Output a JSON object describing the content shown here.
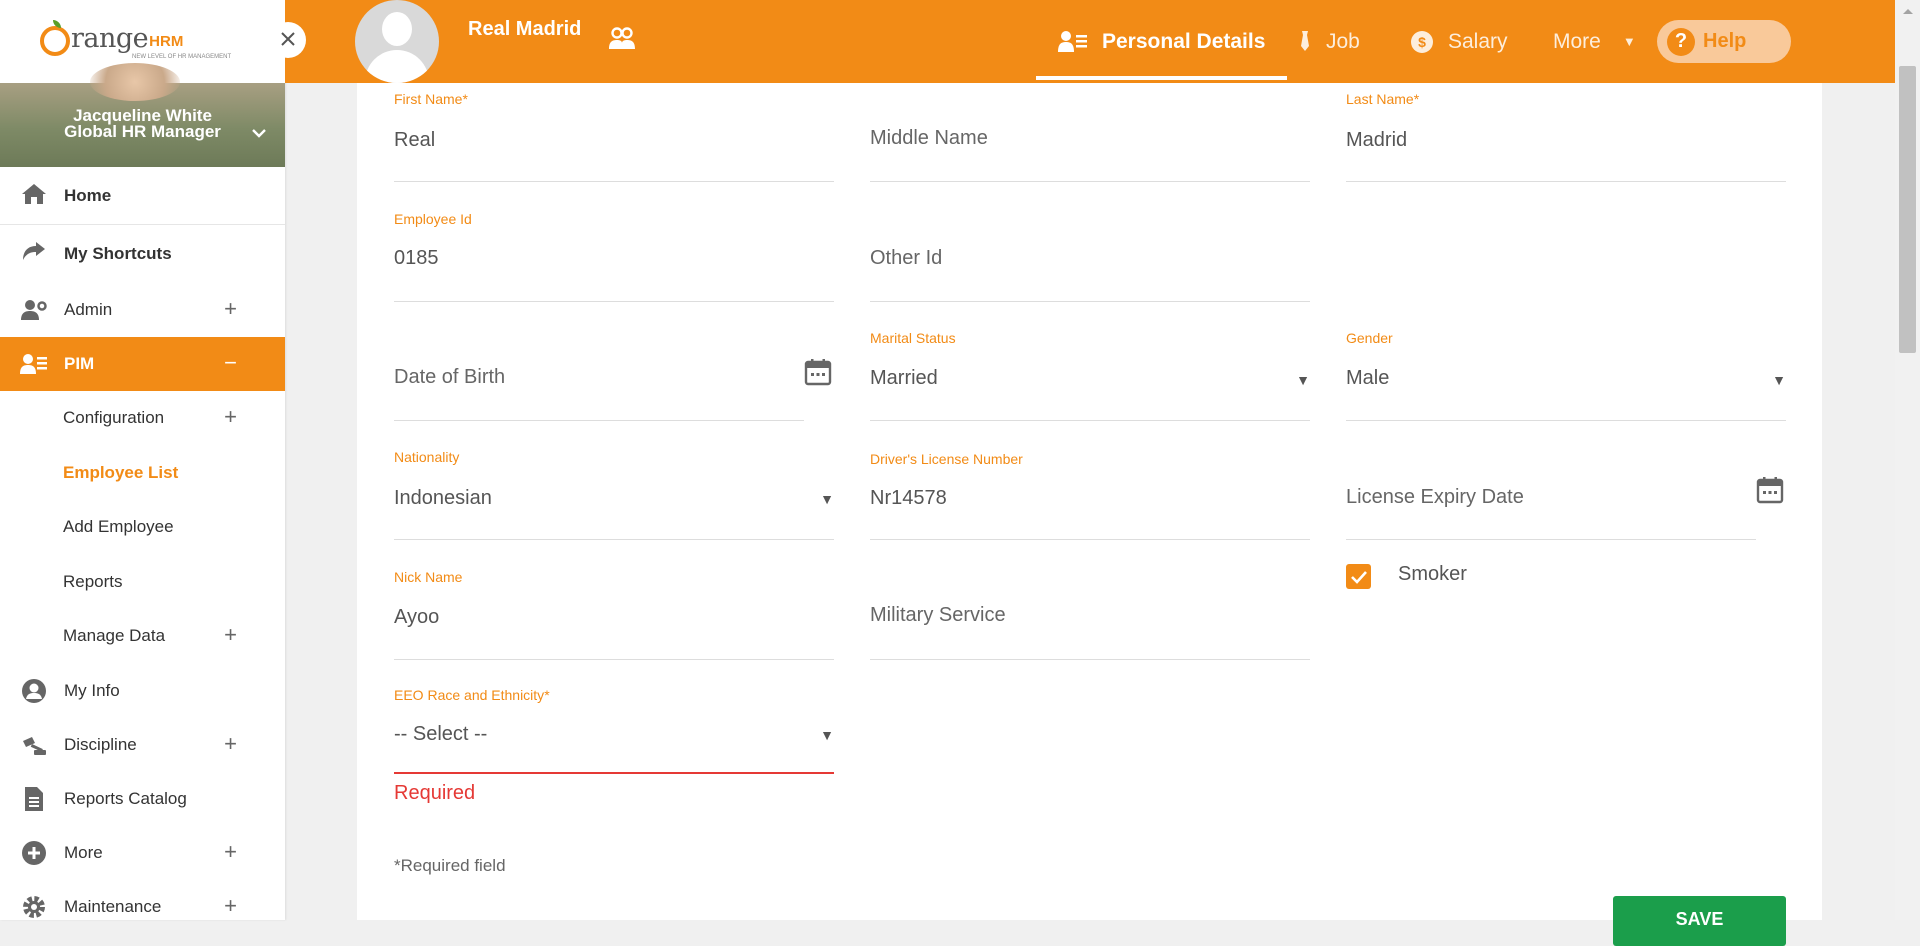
{
  "sidebar": {
    "logo": {
      "text": "range",
      "hrm": "HRM",
      "tagline": "NEW LEVEL OF HR MANAGEMENT"
    },
    "user": {
      "name": "Jacqueline White",
      "role": "Global HR Manager"
    },
    "items": [
      {
        "label": "Home",
        "icon": "home-icon"
      },
      {
        "label": "My Shortcuts",
        "icon": "share-icon"
      },
      {
        "label": "Admin",
        "icon": "admin-icon"
      },
      {
        "label": "PIM",
        "icon": "pim-icon"
      },
      {
        "label": "My Info",
        "icon": "user-circle-icon"
      },
      {
        "label": "Discipline",
        "icon": "discipline-icon"
      },
      {
        "label": "Reports Catalog",
        "icon": "document-icon"
      },
      {
        "label": "More",
        "icon": "plus-circle-icon"
      },
      {
        "label": "Maintenance",
        "icon": "gear-icon"
      }
    ],
    "pim_sub": [
      {
        "label": "Configuration"
      },
      {
        "label": "Employee List"
      },
      {
        "label": "Add Employee"
      },
      {
        "label": "Reports"
      },
      {
        "label": "Manage Data"
      }
    ]
  },
  "header": {
    "employee_name": "Real Madrid",
    "tabs": [
      {
        "label": "Personal Details"
      },
      {
        "label": "Job"
      },
      {
        "label": "Salary"
      },
      {
        "label": "More"
      }
    ],
    "help": "Help"
  },
  "form": {
    "first_name": {
      "label": "First Name",
      "value": "Real"
    },
    "middle_name": {
      "placeholder": "Middle Name"
    },
    "last_name": {
      "label": "Last Name",
      "value": "Madrid"
    },
    "employee_id": {
      "label": "Employee Id",
      "value": "0185"
    },
    "other_id": {
      "placeholder": "Other Id"
    },
    "dob": {
      "placeholder": "Date of Birth"
    },
    "marital_status": {
      "label": "Marital Status",
      "value": "Married"
    },
    "gender": {
      "label": "Gender",
      "value": "Male"
    },
    "nationality": {
      "label": "Nationality",
      "value": "Indonesian"
    },
    "drivers_license": {
      "label": "Driver's License Number",
      "value": "Nr14578"
    },
    "license_expiry": {
      "placeholder": "License Expiry Date"
    },
    "nick_name": {
      "label": "Nick Name",
      "value": "Ayoo"
    },
    "military_service": {
      "placeholder": "Military Service"
    },
    "smoker": {
      "label": "Smoker",
      "checked": true
    },
    "eeo_race": {
      "label": "EEO Race and Ethnicity",
      "value": "-- Select --",
      "error": "Required"
    },
    "required_note": "Required field",
    "save": "SAVE"
  },
  "colors": {
    "accent": "#f28b16",
    "save": "#1b9e4b",
    "error": "#e53935"
  }
}
